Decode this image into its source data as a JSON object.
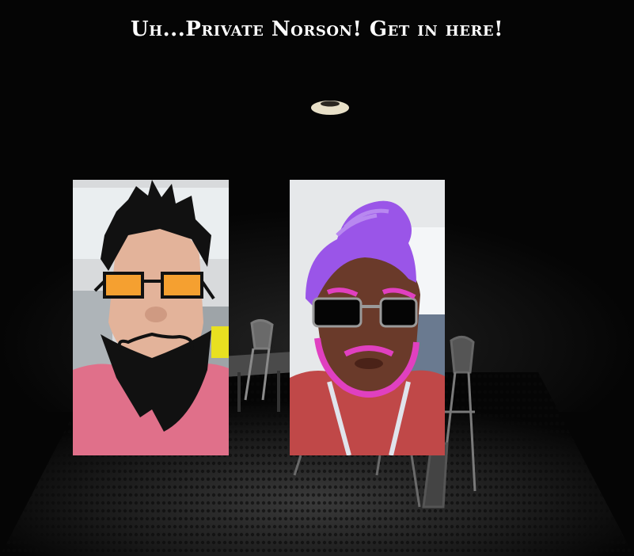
{
  "dialog": {
    "title": "Uh...Private Norson! Get in here!"
  },
  "scene": {
    "background_color": "#050505",
    "floor_color": "#2b2b2b",
    "lamp_color": "#e8e0c8"
  },
  "characters": [
    {
      "id": "left",
      "shirt_color": "#e0708a",
      "hair_color": "#111111",
      "glasses_lens_color": "#f5a030",
      "beard_color": "#111111"
    },
    {
      "id": "right",
      "shirt_color": "#c04848",
      "hair_color": "#9a55e8",
      "glasses_lens_color": "#050505",
      "beard_color": "#e040c0"
    }
  ]
}
